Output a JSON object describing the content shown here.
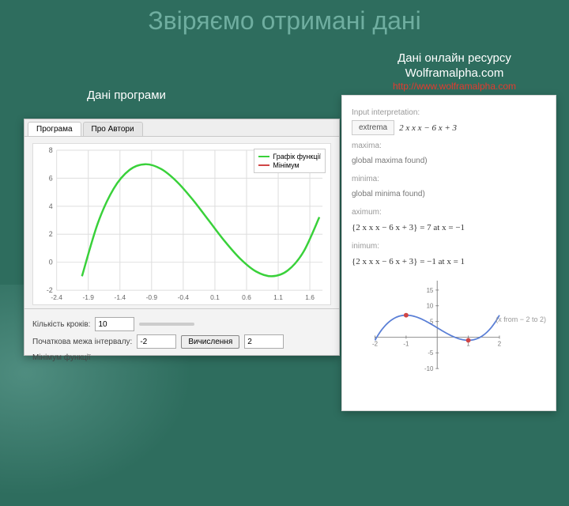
{
  "slide": {
    "title": "Звіряємо отримані дані"
  },
  "labels": {
    "program_data": "Дані програми",
    "online_line1": "Дані онлайн ресурсу",
    "online_line2": "Wolframalpha.com",
    "url": "http://www.wolframalpha.com"
  },
  "app": {
    "tabs": {
      "active": "Програма",
      "inactive": "Про Автори"
    },
    "legend": {
      "curve": "Графік функції",
      "min": "Мінімум"
    },
    "legend_colors": {
      "curve": "#39d13a",
      "min": "#d04545"
    },
    "controls": {
      "steps_label": "Кількість кроків:",
      "steps_value": "10",
      "start_label": "Початкова межа інтервалу:",
      "start_value": "-2",
      "calc_button": "Вичислення",
      "end_value": "2",
      "result_label": "Мінімум функції"
    },
    "axis": {
      "x_ticks": [
        "-2.4",
        "-1.9",
        "-1.4",
        "-0.9",
        "-0.4",
        "0.1",
        "0.6",
        "1.1",
        "1.6"
      ],
      "y_ticks": [
        "-2",
        "0",
        "2",
        "4",
        "6",
        "8"
      ]
    }
  },
  "wolfram": {
    "input_label": "Input interpretation:",
    "chip": "extrema",
    "expression": "2 x x x − 6 x + 3",
    "global_max_h": "maxima:",
    "global_max_text": "global maxima found)",
    "global_min_h": "minima:",
    "global_min_text": "global minima found)",
    "local_max_h": "aximum:",
    "local_max_expr": "{2 x x x − 6 x + 3} = 7  at  x = −1",
    "local_min_h": "inimum:",
    "local_min_expr": "{2 x x x − 6 x + 3} = −1  at  x = 1",
    "plot_caption": "(x from − 2 to 2)",
    "axis": {
      "x_ticks": [
        "-2",
        "-1",
        "1",
        "2"
      ],
      "y_ticks": [
        "-10",
        "-5",
        "5",
        "10",
        "15"
      ]
    }
  },
  "chart_data": [
    {
      "type": "line",
      "title": "",
      "xlabel": "",
      "ylabel": "",
      "xlim": [
        -2.4,
        1.8
      ],
      "ylim": [
        -2,
        8
      ],
      "series": [
        {
          "name": "Графік функції",
          "x": [
            -2.0,
            -1.75,
            -1.5,
            -1.25,
            -1.0,
            -0.75,
            -0.5,
            -0.25,
            0.0,
            0.25,
            0.5,
            0.75,
            1.0,
            1.25,
            1.5,
            1.75
          ],
          "values": [
            -1.0,
            2.78,
            5.25,
            6.59,
            7.0,
            6.66,
            5.75,
            4.47,
            3.0,
            1.53,
            0.25,
            -0.66,
            -1.0,
            -0.59,
            0.75,
            3.22
          ]
        }
      ]
    },
    {
      "type": "line",
      "title": "",
      "xlabel": "",
      "ylabel": "",
      "xlim": [
        -2,
        2
      ],
      "ylim": [
        -10,
        18
      ],
      "series": [
        {
          "name": "2x^3-6x+3",
          "x": [
            -2.0,
            -1.5,
            -1.0,
            -0.5,
            0.0,
            0.5,
            1.0,
            1.5,
            2.0
          ],
          "values": [
            -1.0,
            5.25,
            7.0,
            5.75,
            3.0,
            0.25,
            -1.0,
            0.75,
            7.0
          ]
        }
      ],
      "markers": [
        {
          "x": -1,
          "y": 7,
          "kind": "max"
        },
        {
          "x": 1,
          "y": -1,
          "kind": "min"
        }
      ]
    }
  ]
}
